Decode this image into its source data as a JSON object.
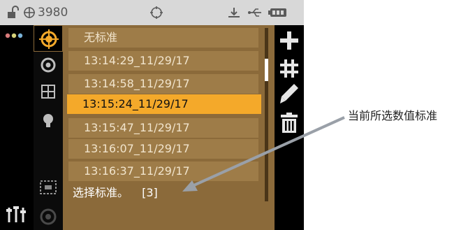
{
  "statusbar": {
    "device_number": "3980"
  },
  "standards_list": {
    "items": [
      {
        "label": "无标准",
        "selected": false
      },
      {
        "label": "13:14:29_11/29/17",
        "selected": false
      },
      {
        "label": "13:14:58_11/29/17",
        "selected": false
      },
      {
        "label": "13:15:24_11/29/17",
        "selected": true
      },
      {
        "label": "13:15:47_11/29/17",
        "selected": false
      },
      {
        "label": "13:16:07_11/29/17",
        "selected": false
      },
      {
        "label": "13:16:37_11/29/17",
        "selected": false
      }
    ]
  },
  "footer": {
    "text": "选择标准。",
    "count": "[3]"
  },
  "annotation": {
    "text": "当前所选数值标准"
  },
  "icons": {
    "statusbar": [
      "lock-icon",
      "target-icon",
      "crosshair-icon",
      "bluetooth-icon",
      "usb-icon",
      "battery-icon"
    ],
    "left": [
      "menu-dots-icon",
      "sliders-icon"
    ],
    "tools": [
      "target-active-icon",
      "ring-icon",
      "grid-icon",
      "bulb-icon",
      "frame-icon",
      "disabled-circle-icon"
    ],
    "right": [
      "add-icon",
      "hash-icon",
      "edit-icon",
      "delete-icon"
    ]
  },
  "colors": {
    "selected_row": "#f4a92a",
    "row": "#9e7c48",
    "panel": "#8b6a3a",
    "dot_colors": [
      "#d97b7b",
      "#d7d37a",
      "#7ab3d9"
    ]
  }
}
